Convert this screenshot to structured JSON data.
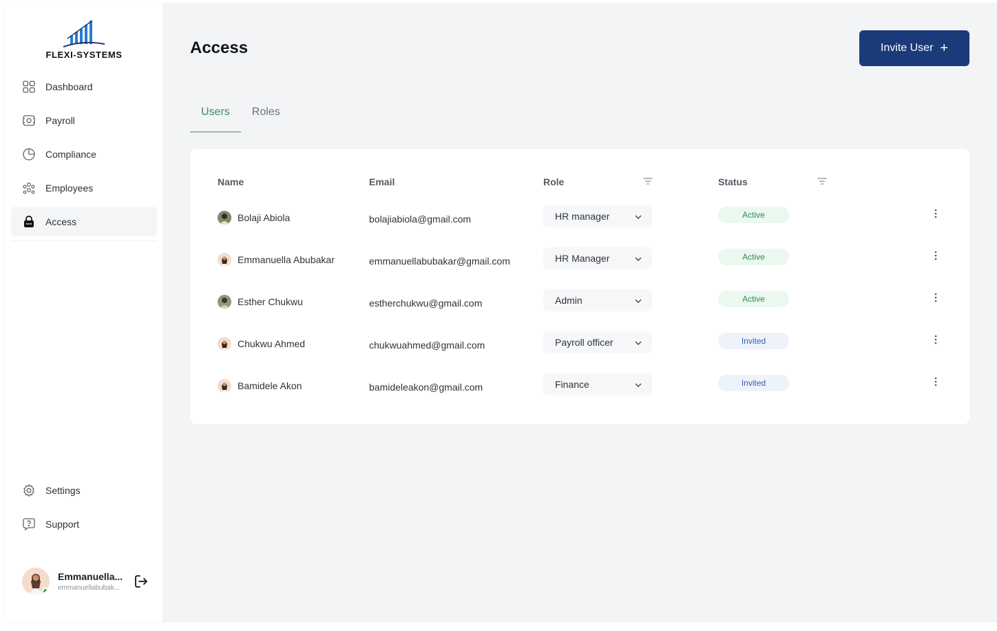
{
  "app": {
    "brand": "FLEXI-SYSTEMS"
  },
  "sidebar": {
    "items": [
      {
        "label": "Dashboard",
        "icon": "grid-icon"
      },
      {
        "label": "Payroll",
        "icon": "payroll-icon"
      },
      {
        "label": "Compliance",
        "icon": "pie-chart-icon"
      },
      {
        "label": "Employees",
        "icon": "people-icon"
      },
      {
        "label": "Access",
        "icon": "lock-icon",
        "active": true
      }
    ],
    "bottom_items": [
      {
        "label": "Settings",
        "icon": "gear-icon"
      },
      {
        "label": "Support",
        "icon": "help-chat-icon"
      }
    ],
    "profile": {
      "name": "Emmanuella...",
      "email": "emmanuellabubak...",
      "online": true
    }
  },
  "header": {
    "title": "Access",
    "invite_label": "Invite User",
    "invite_icon": "plus-icon"
  },
  "tabs": [
    {
      "label": "Users",
      "active": true
    },
    {
      "label": "Roles",
      "active": false
    }
  ],
  "table": {
    "columns": {
      "name": "Name",
      "email": "Email",
      "role": "Role",
      "status": "Status"
    },
    "rows": [
      {
        "name": "Bolaji Abiola",
        "email": "bolajiabiola@gmail.com",
        "role": "HR manager",
        "status": "Active"
      },
      {
        "name": "Emmanuella Abubakar",
        "email": "emmanuellabubakar@gmail.com",
        "role": "HR Manager",
        "status": "Active"
      },
      {
        "name": "Esther Chukwu",
        "email": "estherchukwu@gmail.com",
        "role": "Admin",
        "status": "Active"
      },
      {
        "name": "Chukwu Ahmed",
        "email": "chukwuahmed@gmail.com",
        "role": "Payroll officer",
        "status": "Invited"
      },
      {
        "name": "Bamidele Akon",
        "email": "bamideleakon@gmail.com",
        "role": "Finance",
        "status": "Invited"
      }
    ]
  },
  "colors": {
    "primary": "#1b3a7a",
    "tab_active": "#3f8a5d",
    "status_active_bg": "#ebf8ef",
    "status_active_text": "#2d8a4e",
    "status_invited_bg": "#eef3fb",
    "status_invited_text": "#2f5fb3",
    "online": "#1f9d55"
  }
}
